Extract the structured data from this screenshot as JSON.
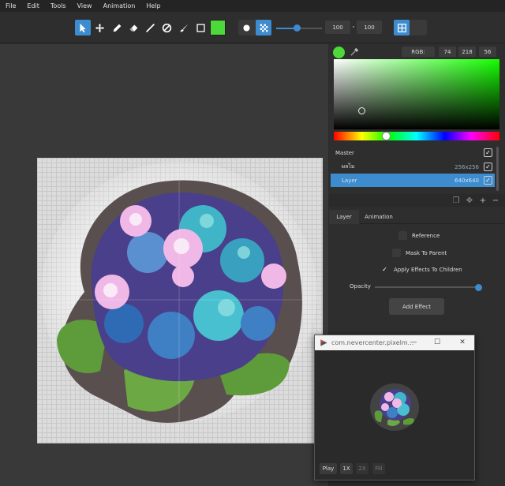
{
  "menubar": {
    "items": [
      "File",
      "Edit",
      "Tools",
      "View",
      "Animation",
      "Help"
    ]
  },
  "toolbar": {
    "tools": [
      "pointer-icon",
      "move-icon",
      "pencil-icon",
      "eraser-icon",
      "line-icon",
      "circle-slash-icon",
      "brush-icon",
      "rectangle-icon"
    ],
    "primary_color": "#4dd93a",
    "brush_size": "100",
    "brush_opacity": "100",
    "size_slider_fraction": 0.45
  },
  "color_picker": {
    "mode_label": "RGB:",
    "r": "74",
    "g": "218",
    "b": "56",
    "current_color": "#4dd93a"
  },
  "layers": {
    "rows": [
      {
        "name": "Master",
        "size": "",
        "checked": true
      },
      {
        "name": "ผลไม",
        "size": "256x256",
        "checked": true
      },
      {
        "name": "Layer",
        "size": "640x640",
        "checked": true
      }
    ]
  },
  "tabs": [
    "Layer",
    "Animation"
  ],
  "layer_props": {
    "reference_label": "Reference",
    "mask_label": "Mask To Parent",
    "apply_effects_label": "Apply Effects To Children",
    "opacity_label": "Opacity",
    "opacity_value": 1.0,
    "add_effect_label": "Add Effect"
  },
  "preview": {
    "title": "com.nevercenter.pixelm...",
    "buttons": [
      "Play",
      "1X",
      "2X",
      "Fill"
    ]
  }
}
